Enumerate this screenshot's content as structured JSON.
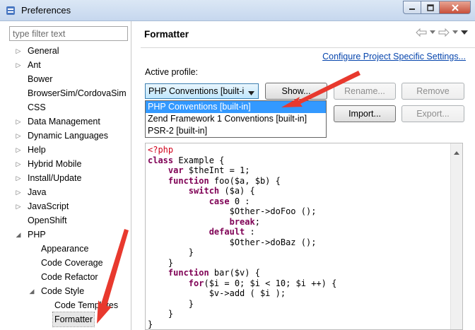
{
  "window": {
    "title": "Preferences"
  },
  "filter": {
    "placeholder": "type filter text"
  },
  "tree": [
    {
      "label": "General",
      "arrow": "▷",
      "level": 0
    },
    {
      "label": "Ant",
      "arrow": "▷",
      "level": 0
    },
    {
      "label": "Bower",
      "arrow": "",
      "level": 0
    },
    {
      "label": "BrowserSim/CordovaSim",
      "arrow": "",
      "level": 0
    },
    {
      "label": "CSS",
      "arrow": "",
      "level": 0
    },
    {
      "label": "Data Management",
      "arrow": "▷",
      "level": 0
    },
    {
      "label": "Dynamic Languages",
      "arrow": "▷",
      "level": 0
    },
    {
      "label": "Help",
      "arrow": "▷",
      "level": 0
    },
    {
      "label": "Hybrid Mobile",
      "arrow": "▷",
      "level": 0
    },
    {
      "label": "Install/Update",
      "arrow": "▷",
      "level": 0
    },
    {
      "label": "Java",
      "arrow": "▷",
      "level": 0
    },
    {
      "label": "JavaScript",
      "arrow": "▷",
      "level": 0
    },
    {
      "label": "OpenShift",
      "arrow": "",
      "level": 0
    },
    {
      "label": "PHP",
      "arrow": "◢",
      "level": 0
    },
    {
      "label": "Appearance",
      "arrow": "",
      "level": 1
    },
    {
      "label": "Code Coverage",
      "arrow": "",
      "level": 1
    },
    {
      "label": "Code Refactor",
      "arrow": "",
      "level": 1
    },
    {
      "label": "Code Style",
      "arrow": "◢",
      "level": 1
    },
    {
      "label": "Code Templates",
      "arrow": "",
      "level": 2
    },
    {
      "label": "Formatter",
      "arrow": "",
      "level": 2,
      "selected": true
    }
  ],
  "page": {
    "title": "Formatter",
    "config_link": "Configure Project Specific Settings...",
    "active_profile_label": "Active profile:",
    "selected_profile": "PHP Conventions [built-i",
    "buttons": {
      "show": "Show...",
      "rename": "Rename...",
      "remove": "Remove",
      "import": "Import...",
      "export": "Export..."
    },
    "profile_options": [
      "PHP Conventions [built-in]",
      "Zend Framework 1 Conventions [built-in]",
      "PSR-2 [built-in]"
    ]
  },
  "code_preview": [
    [
      {
        "t": "<?php",
        "c": "tag"
      }
    ],
    [
      {
        "t": "class",
        "c": "kw"
      },
      {
        "t": " Example {"
      }
    ],
    [
      {
        "t": "    "
      },
      {
        "t": "var",
        "c": "kw"
      },
      {
        "t": " $theInt = 1;"
      }
    ],
    [
      {
        "t": "    "
      },
      {
        "t": "function",
        "c": "kw"
      },
      {
        "t": " foo($a, $b) {"
      }
    ],
    [
      {
        "t": "        "
      },
      {
        "t": "switch",
        "c": "kw"
      },
      {
        "t": " ($a) {"
      }
    ],
    [
      {
        "t": "            "
      },
      {
        "t": "case",
        "c": "kw"
      },
      {
        "t": " 0 :"
      }
    ],
    [
      {
        "t": "                $Other->doFoo ();"
      }
    ],
    [
      {
        "t": "                "
      },
      {
        "t": "break",
        "c": "kw"
      },
      {
        "t": ";"
      }
    ],
    [
      {
        "t": "            "
      },
      {
        "t": "default",
        "c": "kw"
      },
      {
        "t": " :"
      }
    ],
    [
      {
        "t": "                $Other->doBaz ();"
      }
    ],
    [
      {
        "t": "        }"
      }
    ],
    [
      {
        "t": "    }"
      }
    ],
    [
      {
        "t": "    "
      },
      {
        "t": "function",
        "c": "kw"
      },
      {
        "t": " bar($v) {"
      }
    ],
    [
      {
        "t": "        "
      },
      {
        "t": "for",
        "c": "kw"
      },
      {
        "t": "($i = 0; $i < 10; $i ++) {"
      }
    ],
    [
      {
        "t": "            $v->add ( $i );"
      }
    ],
    [
      {
        "t": "        }"
      }
    ],
    [
      {
        "t": "    }"
      }
    ],
    [
      {
        "t": "}"
      }
    ]
  ],
  "colors": {
    "annotation_arrow": "#e8392e",
    "selection": "#3399ff",
    "link": "#0645ad",
    "keyword": "#7f0055"
  }
}
